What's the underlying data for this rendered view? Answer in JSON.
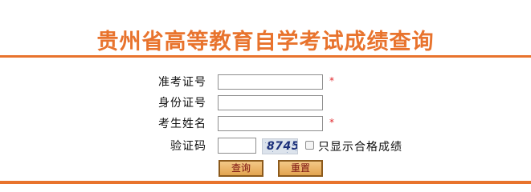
{
  "header": {
    "title": "贵州省高等教育自学考试成绩查询"
  },
  "form": {
    "ticket_label": "准考证号",
    "id_label": "身份证号",
    "name_label": "考生姓名",
    "captcha_label": "验证码",
    "required_mark": "*",
    "captcha_text": "8745",
    "pass_only_label": "只显示合格成绩",
    "pass_only_checked": false
  },
  "buttons": {
    "query_label": "查询",
    "reset_label": "重置"
  },
  "colors": {
    "accent": "#e8732d",
    "required": "#e0262b",
    "button_text": "#7a0f0f"
  }
}
